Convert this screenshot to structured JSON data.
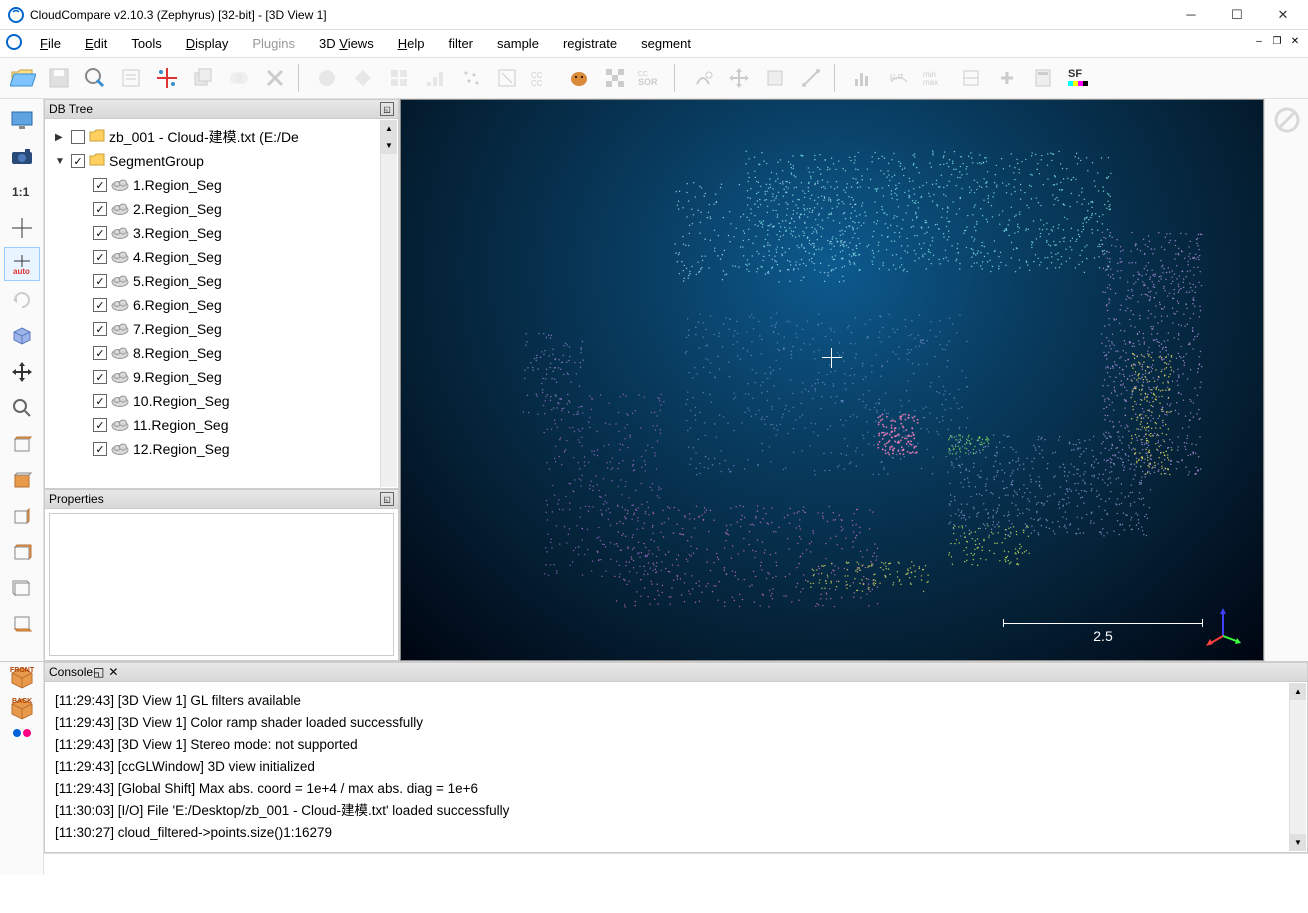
{
  "window": {
    "title": "CloudCompare v2.10.3 (Zephyrus) [32-bit] - [3D View 1]"
  },
  "menu": {
    "file": "File",
    "edit": "Edit",
    "tools": "Tools",
    "display": "Display",
    "plugins": "Plugins",
    "views": "3D Views",
    "help": "Help",
    "filter": "filter",
    "sample": "sample",
    "registrate": "registrate",
    "segment": "segment"
  },
  "panels": {
    "dbtree": "DB Tree",
    "properties": "Properties",
    "console": "Console"
  },
  "tree": {
    "root1": "zb_001 - Cloud-建模.txt (E:/De",
    "root2": "SegmentGroup",
    "regions": [
      "1.Region_Seg",
      "2.Region_Seg",
      "3.Region_Seg",
      "4.Region_Seg",
      "5.Region_Seg",
      "6.Region_Seg",
      "7.Region_Seg",
      "8.Region_Seg",
      "9.Region_Seg",
      "10.Region_Seg",
      "11.Region_Seg",
      "12.Region_Seg"
    ]
  },
  "viewport": {
    "scale": "2.5"
  },
  "console_lines": [
    "[11:29:43] [3D View 1] GL filters available",
    "[11:29:43] [3D View 1] Color ramp shader loaded successfully",
    "[11:29:43] [3D View 1] Stereo mode: not supported",
    "[11:29:43] [ccGLWindow] 3D view initialized",
    "[11:29:43] [Global Shift] Max abs. coord = 1e+4 / max abs. diag = 1e+6",
    "[11:30:03] [I/O] File 'E:/Desktop/zb_001 - Cloud-建模.txt' loaded successfully",
    "[11:30:27] cloud_filtered->points.size()1:16279"
  ]
}
